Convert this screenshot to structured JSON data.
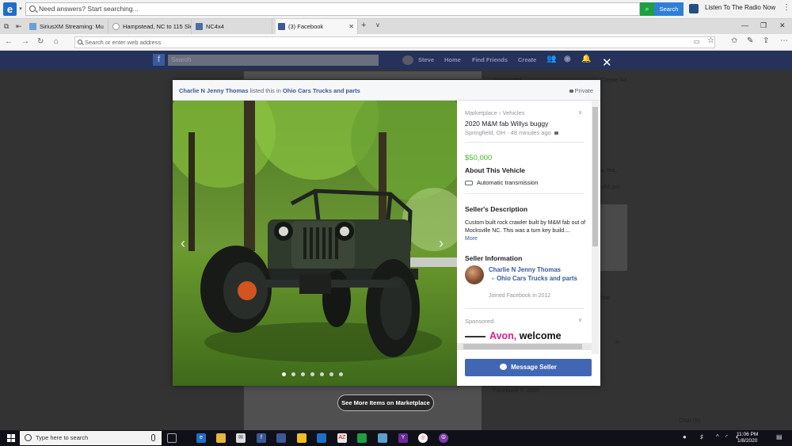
{
  "search_bar": {
    "placeholder": "Need answers? Start searching...",
    "search_button": "Search",
    "radio_label": "Listen To The Radio Now"
  },
  "tabs": [
    {
      "label": "SiriusXM Streaming: Mu",
      "color": "#6aa0d8"
    },
    {
      "label": "Hampstead, NC to 115 Slee",
      "color": "#ffffff"
    },
    {
      "label": "NC4x4",
      "color": "#4a6fa5"
    },
    {
      "label": "(3) Facebook",
      "color": "#3b5998"
    }
  ],
  "address_bar": {
    "placeholder": "Search or enter web address"
  },
  "facebook_header": {
    "search_placeholder": "Search",
    "nav": [
      "Steve",
      "Home",
      "Find Friends",
      "Create"
    ]
  },
  "background_texts": {
    "sponsored": "Sponsored",
    "create_ad": "Create Ad",
    "inc": "s, Inc.",
    "build_got": "uild got",
    "that": "that",
    "copyright": "Facebook © 2020",
    "chat": "Chat (6)"
  },
  "modal": {
    "header": {
      "poster": "Charlie N Jenny Thomas",
      "listed_text": "listed this in",
      "group": "Ohio Cars Trucks and parts",
      "privacy": "Private"
    },
    "photo": {
      "dot_count": 7,
      "active_dot": 0
    },
    "listing": {
      "breadcrumb": "Marketplace › Vehicles",
      "title": "2020 M&M fab Willys buggy",
      "location_time": "Springfield, OH · 48 minutes ago",
      "price": "$50,000",
      "about_heading": "About This Vehicle",
      "transmission": "Automatic transmission",
      "description_heading": "Seller's Description",
      "description": "Custom built rock crawler built by M&M fab out of Mocksville NC. This was a turn key build....",
      "more_label": "More",
      "seller_heading": "Seller Information",
      "seller_name": "Charlie N Jenny Thomas",
      "seller_group": "Ohio Cars Trucks and parts",
      "joined": "Joined Facebook in 2012",
      "sponsored": "Sponsored",
      "ad_brand": "Avon,",
      "ad_tagline": "welcome",
      "message_button": "Message Seller"
    }
  },
  "see_more": "See More Items on Marketplace",
  "taskbar": {
    "search_placeholder": "Type here to search",
    "time": "11:06 PM",
    "date": "1/8/2020"
  },
  "colors": {
    "facebook_blue": "#4267b2",
    "price_green": "#42b72a",
    "link_blue": "#385898",
    "avon_pink": "#d91e8a"
  }
}
